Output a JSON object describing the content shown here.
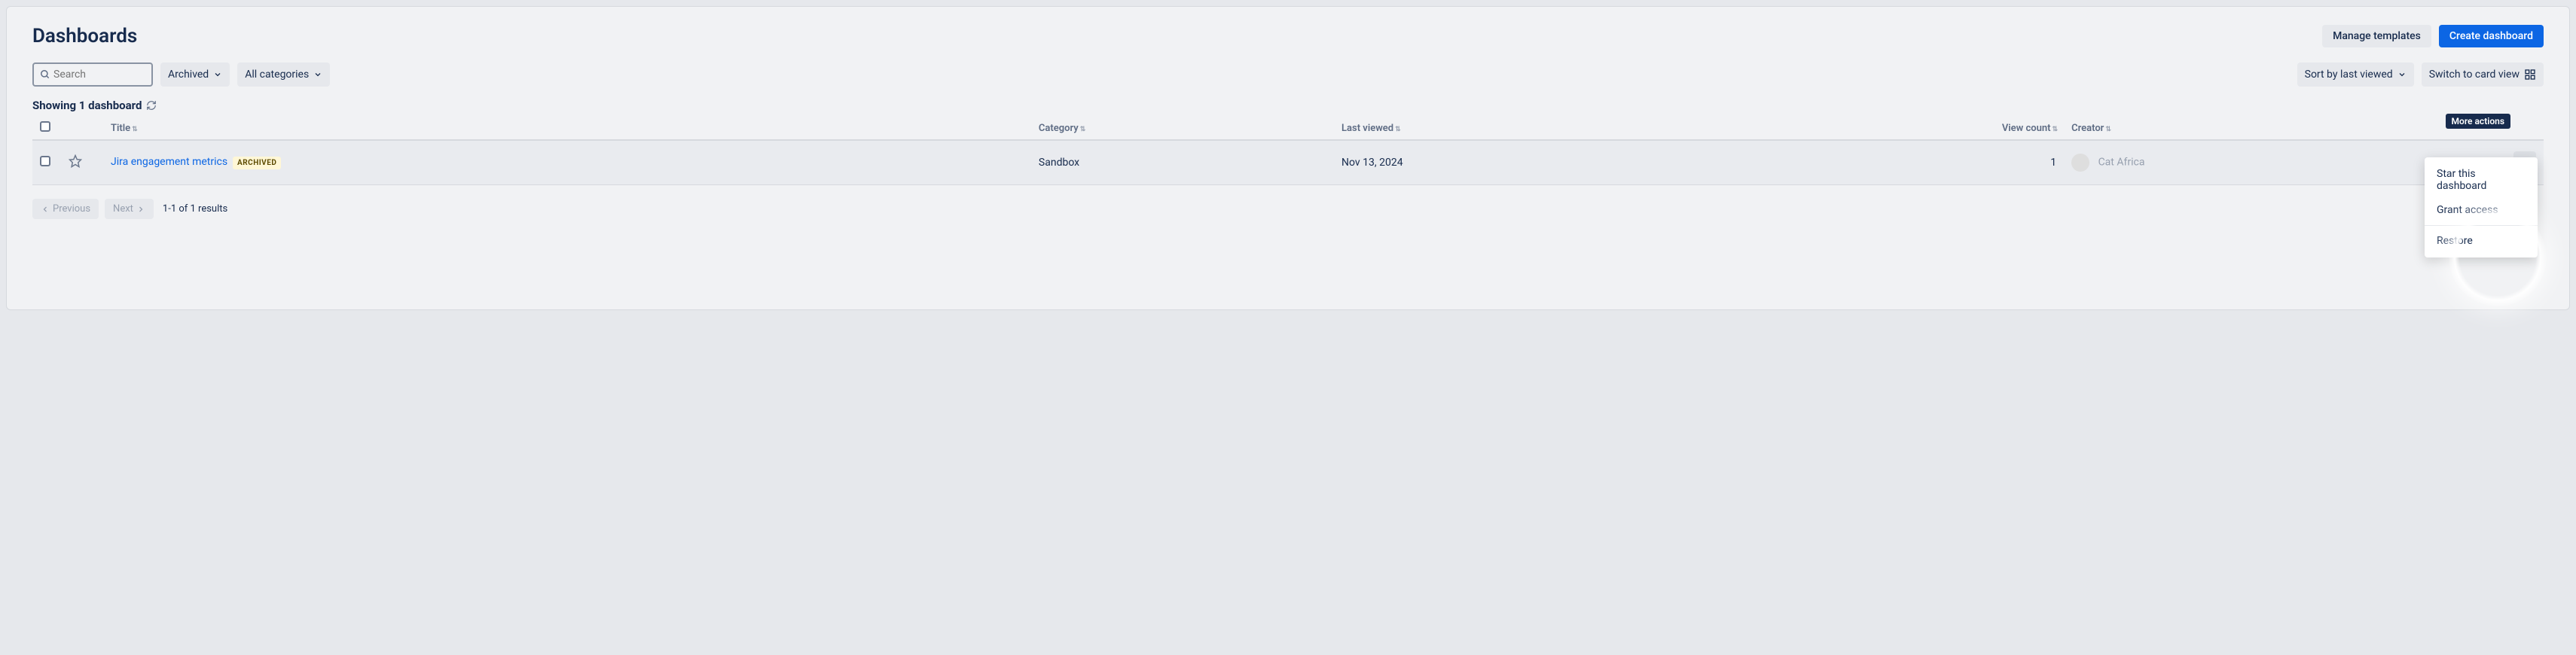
{
  "page_title": "Dashboards",
  "buttons": {
    "manage_templates": "Manage templates",
    "create_dashboard": "Create dashboard"
  },
  "search": {
    "placeholder": "Search"
  },
  "filters": {
    "archived": "Archived",
    "categories": "All categories"
  },
  "sort": {
    "label": "Sort by last viewed"
  },
  "view_switch": {
    "label": "Switch to card view"
  },
  "showing": "Showing 1 dashboard",
  "columns": {
    "title": "Title",
    "category": "Category",
    "last_viewed": "Last viewed",
    "view_count": "View count",
    "creator": "Creator"
  },
  "tooltip_more": "More actions",
  "row": {
    "title": "Jira engagement metrics",
    "badge": "ARCHIVED",
    "category": "Sandbox",
    "last_viewed": "Nov 13, 2024",
    "view_count": "1",
    "creator": "Cat Africa"
  },
  "pager": {
    "prev": "Previous",
    "next": "Next",
    "summary": "1-1 of 1 results"
  },
  "menu": {
    "star": "Star this dashboard",
    "grant": "Grant access",
    "restore": "Restore"
  }
}
